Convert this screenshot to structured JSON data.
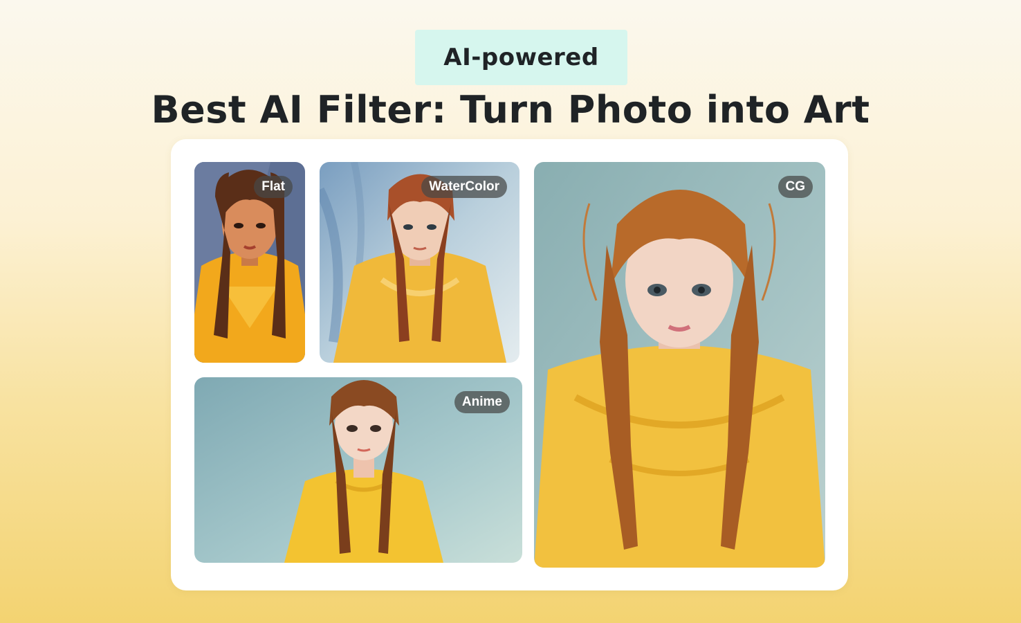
{
  "header": {
    "badge_label": "AI-powered",
    "title": "Best AI Filter: Turn Photo into Art"
  },
  "gallery": {
    "items": [
      {
        "id": "flat",
        "label": "Flat",
        "palette": {
          "bg": "#5d6f94",
          "hair": "#5a2e18",
          "dress": "#f2a81c",
          "skin": "#d98c5c"
        }
      },
      {
        "id": "watercolor",
        "label": "WaterColor",
        "palette": {
          "bg": "#9fb8cc",
          "hair": "#a9502a",
          "dress": "#f0b93a",
          "skin": "#f0cdb6"
        }
      },
      {
        "id": "anime",
        "label": "Anime",
        "palette": {
          "bg": "#8fb5bb",
          "hair": "#8a4a22",
          "dress": "#f3c331",
          "skin": "#f3d7c6"
        }
      },
      {
        "id": "cg",
        "label": "CG",
        "palette": {
          "bg": "#98b7b9",
          "hair": "#b86a2a",
          "dress": "#f2c13f",
          "skin": "#f2d5c5"
        }
      }
    ]
  }
}
